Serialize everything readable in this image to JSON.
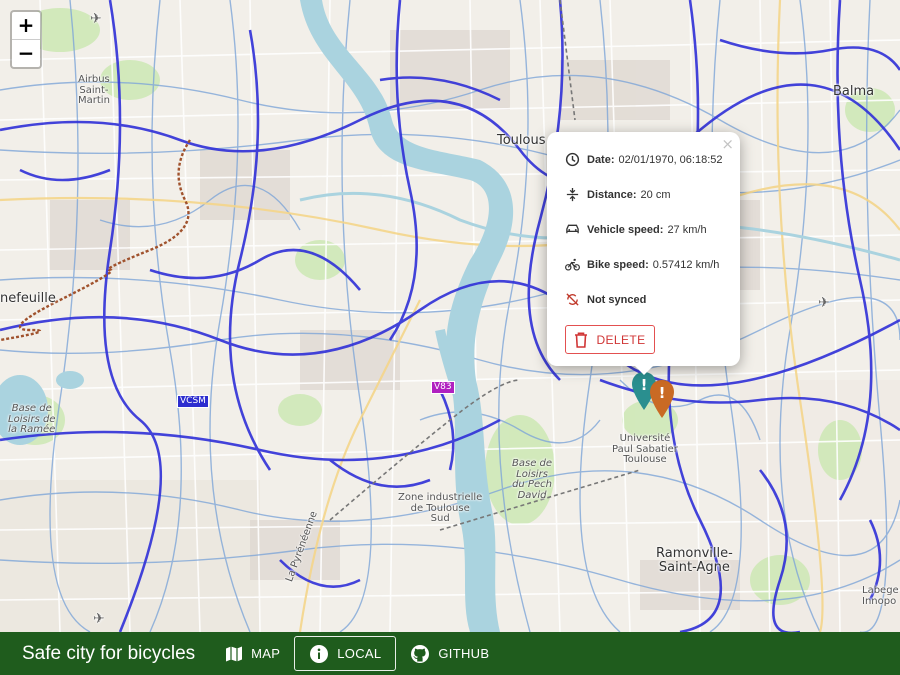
{
  "map": {
    "labels": {
      "toulouse": "Toulous",
      "balma": "Balma",
      "airbus": "Airbus\nSaint-\nMartin",
      "tournefeuille": "nefeuille",
      "base_ramee": "Base de\nLoisirs de\nla Ramée",
      "universite": "Université\nPaul Sabatier\nToulouse",
      "base_pech": "Base de\nLoisirs\ndu Pech\nDavid",
      "zone_ind": "Zone industrielle\nde Toulouse\nSud",
      "ramonville": "Ramonville-\nSaint-Agne",
      "labege": "Labege\nInnopo",
      "ramonville_short": "Ramonville",
      "pyreneenne": "La Pyrénéenne"
    },
    "shields": {
      "vcsm": "VCSM",
      "v83": "V83"
    },
    "colors": {
      "bike_route": "#3030d8",
      "river": "#aad3df",
      "park": "#c8e6b0",
      "trail": "#a0522d"
    }
  },
  "zoom": {
    "in_label": "+",
    "out_label": "−"
  },
  "popup": {
    "close_label": "×",
    "date_label": "Date:",
    "date_value": "02/01/1970, 06:18:52",
    "distance_label": "Distance:",
    "distance_value": "20 cm",
    "vehicle_label": "Vehicle speed:",
    "vehicle_value": "27 km/h",
    "bike_label": "Bike speed:",
    "bike_value": "0.57412 km/h",
    "sync_label": "Not synced",
    "delete_label": "DELETE",
    "delete_color": "#d03535"
  },
  "markers": {
    "teal": {
      "color": "#2a8f8f",
      "glyph": "!"
    },
    "orange": {
      "color": "#c96a24",
      "glyph": "!"
    }
  },
  "bottom_bar": {
    "title": "Safe city for bicycles",
    "background": "#1f5c1d",
    "nav": [
      {
        "label": "MAP",
        "icon": "map-icon"
      },
      {
        "label": "LOCAL",
        "icon": "info-icon",
        "active": true
      },
      {
        "label": "GITHUB",
        "icon": "github-icon"
      }
    ]
  }
}
